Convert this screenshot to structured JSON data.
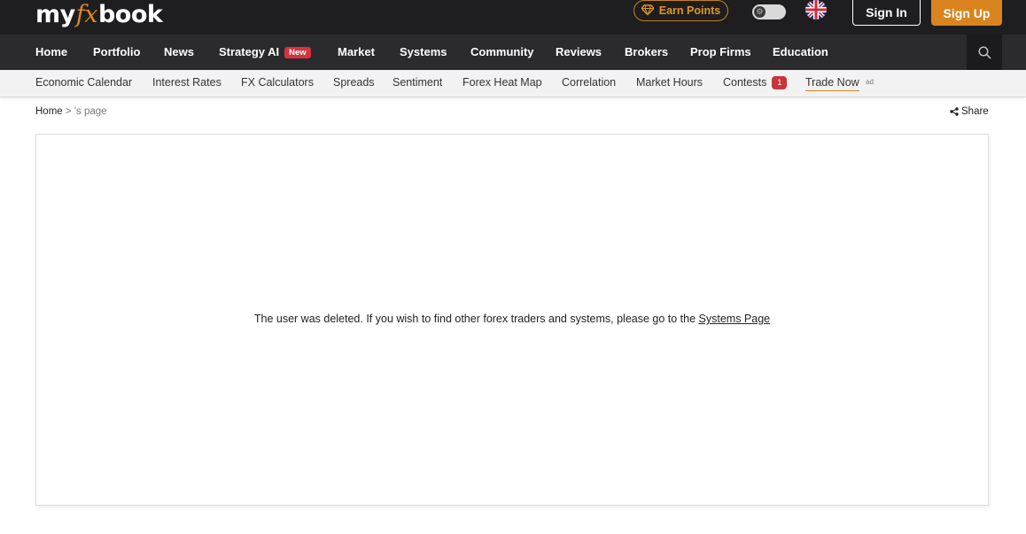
{
  "header": {
    "logo": {
      "my": "my",
      "fx": "fx",
      "book": "book"
    },
    "earn_points": "Earn Points",
    "sign_in": "Sign In",
    "sign_up": "Sign Up"
  },
  "main_nav": {
    "items": [
      "Home",
      "Portfolio",
      "News",
      "Strategy AI",
      "Market",
      "Systems",
      "Community",
      "Reviews",
      "Brokers",
      "Prop Firms",
      "Education"
    ],
    "new_badge": "New"
  },
  "sub_nav": {
    "items": [
      "Economic Calendar",
      "Interest Rates",
      "FX Calculators",
      "Spreads",
      "Sentiment",
      "Forex Heat Map",
      "Correlation",
      "Market Hours",
      "Contests",
      "Trade Now"
    ],
    "contests_count": "1",
    "ad_label": "ad"
  },
  "breadcrumb": {
    "home": "Home",
    "separator": " > ",
    "current": "'s page"
  },
  "share": {
    "label": "Share"
  },
  "content": {
    "message": "The user was deleted. If you wish to find other forex traders and systems, please go to the ",
    "link": "Systems Page"
  },
  "colors": {
    "accent": "#d9841f",
    "topbar": "#1e1e20",
    "nav": "#2b2b2e",
    "badge": "#d5343e"
  }
}
